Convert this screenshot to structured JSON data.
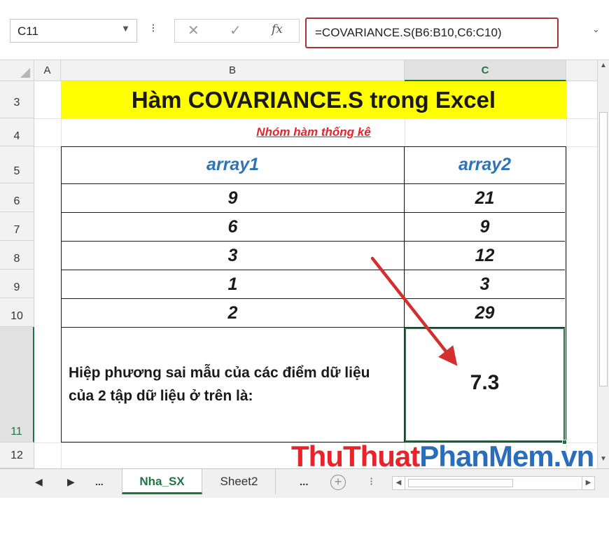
{
  "formula_bar": {
    "name_box": "C11",
    "name_box_dropdown": "▼",
    "options_dots": "⁝",
    "cancel_icon": "✕",
    "enter_icon": "✓",
    "fx_label": "fx",
    "formula": "=COVARIANCE.S(B6:B10,C6:C10)",
    "expand_icon": "⌄"
  },
  "columns": [
    "A",
    "B",
    "C"
  ],
  "rows": [
    "3",
    "4",
    "5",
    "6",
    "7",
    "8",
    "9",
    "10",
    "11",
    "12"
  ],
  "sheet": {
    "title": "Hàm COVARIANCE.S trong Excel",
    "subtitle": "Nhóm hàm thống kê",
    "table": {
      "headers": [
        "array1",
        "array2"
      ],
      "data": [
        [
          "9",
          "21"
        ],
        [
          "6",
          "9"
        ],
        [
          "3",
          "12"
        ],
        [
          "1",
          "3"
        ],
        [
          "2",
          "29"
        ]
      ],
      "result_label": "Hiệp phương sai mẫu của các điểm dữ liệu của 2 tập dữ liệu ở trên là:",
      "result_value": "7.3"
    },
    "watermark": {
      "part1": "ThuThuat",
      "part2": "PhanMem.vn"
    }
  },
  "tabs": {
    "nav_prev": "◀",
    "nav_next": "▶",
    "more_left": "...",
    "active": "Nha_SX",
    "other": "Sheet2",
    "more_right": "...",
    "add_icon": "+",
    "divider": "⁝"
  },
  "colors": {
    "excel_green": "#217346",
    "title_fill": "#ffff00",
    "subtitle_red": "#e8232a",
    "header_blue": "#2e74b5",
    "formula_highlight": "#a83232",
    "arrow_red": "#d32f2f"
  }
}
